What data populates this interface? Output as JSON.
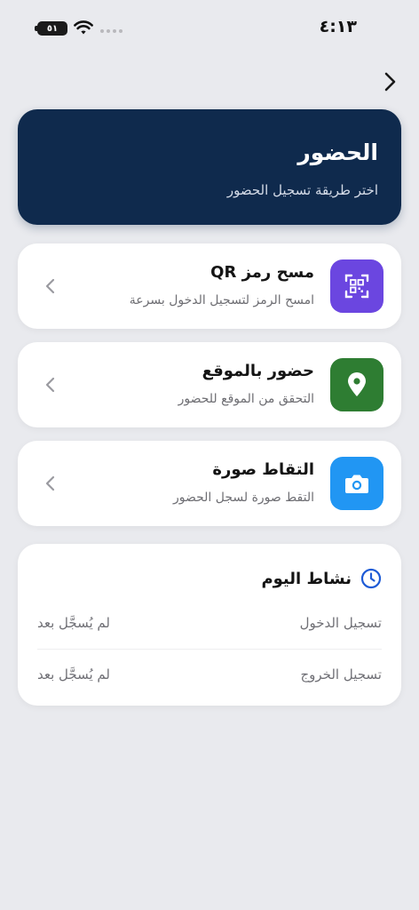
{
  "status_bar": {
    "time": "٤:١٣",
    "battery": "٥١"
  },
  "hero": {
    "title": "الحضور",
    "subtitle": "اختر طريقة تسجيل الحضور"
  },
  "options": [
    {
      "title": "مسح رمز QR",
      "subtitle": "امسح الرمز لتسجيل الدخول بسرعة",
      "icon": "qr-code-icon",
      "color": "#6b46e0"
    },
    {
      "title": "حضور بالموقع",
      "subtitle": "التحقق من الموقع للحضور",
      "icon": "location-pin-icon",
      "color": "#2e7d32"
    },
    {
      "title": "التقاط صورة",
      "subtitle": "التقط صورة لسجل الحضور",
      "icon": "camera-icon",
      "color": "#2196f3"
    }
  ],
  "activity": {
    "title": "نشاط اليوم",
    "icon": "clock-icon",
    "accent": "#1e5bd6",
    "rows": [
      {
        "label": "تسجيل الدخول",
        "value": "لم يُسجَّل بعد"
      },
      {
        "label": "تسجيل الخروج",
        "value": "لم يُسجَّل بعد"
      }
    ]
  }
}
